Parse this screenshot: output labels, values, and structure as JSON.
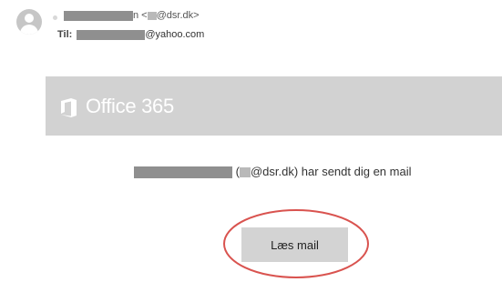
{
  "header": {
    "from_suffix": "n <",
    "from_domain": "@dsr.dk>",
    "to_label": "Til:",
    "to_domain": "@yahoo.com"
  },
  "banner": {
    "product_name": "Office 365"
  },
  "body": {
    "message_open": "(",
    "message_tail": "@dsr.dk) har sendt dig en mail",
    "button_label": "Læs mail"
  },
  "colors": {
    "banner_bg": "#d2d2d2",
    "button_bg": "#d3d3d3",
    "highlight_ring": "#d9534f",
    "redaction": "#8f8f8f"
  },
  "icons": {
    "avatar": "user-avatar-icon",
    "logo": "office-logo-icon"
  }
}
